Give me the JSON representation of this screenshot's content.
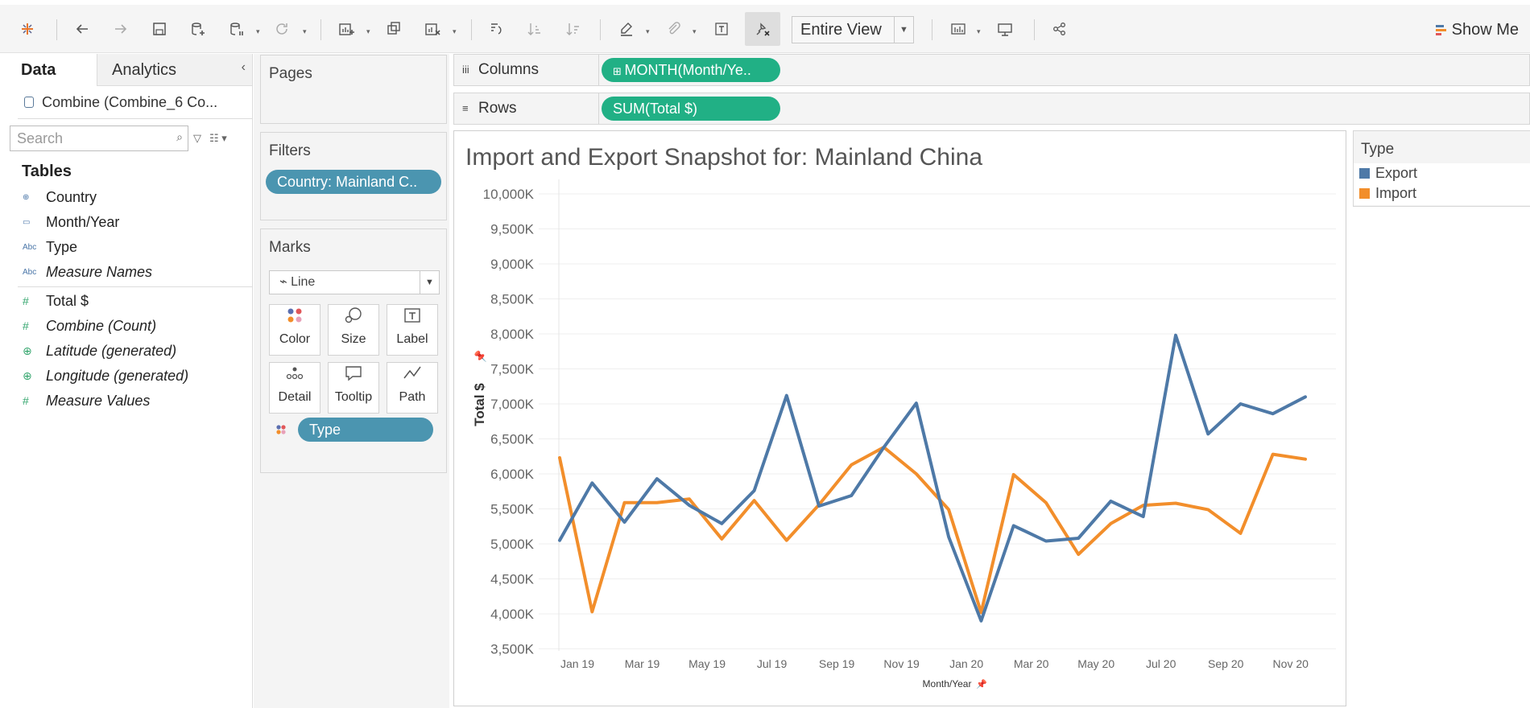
{
  "toolbar": {
    "fit_value": "Entire View",
    "show_me_label": "Show Me"
  },
  "left_pane": {
    "tabs": [
      {
        "label": "Data",
        "active": true
      },
      {
        "label": "Analytics",
        "active": false
      }
    ],
    "datasource": "Combine (Combine_6 Co...",
    "search_placeholder": "Search",
    "tables_heading": "Tables",
    "dimensions": [
      {
        "label": "Country",
        "icon": "globe-icon"
      },
      {
        "label": "Month/Year",
        "icon": "calendar-icon"
      },
      {
        "label": "Type",
        "icon": "abc-icon"
      },
      {
        "label": "Measure Names",
        "icon": "abc-icon"
      }
    ],
    "measures": [
      {
        "label": "Total $",
        "icon": "hash-icon"
      },
      {
        "label": "Combine (Count)",
        "icon": "hash-icon"
      },
      {
        "label": "Latitude (generated)",
        "icon": "globe-icon"
      },
      {
        "label": "Longitude (generated)",
        "icon": "globe-icon"
      },
      {
        "label": "Measure Values",
        "icon": "hash-icon"
      }
    ]
  },
  "pages_card": {
    "title": "Pages"
  },
  "filters_card": {
    "title": "Filters",
    "pill": "Country: Mainland C.."
  },
  "marks_card": {
    "title": "Marks",
    "mark_type": "Line",
    "buttons": [
      "Color",
      "Size",
      "Label",
      "Detail",
      "Tooltip",
      "Path"
    ],
    "pill": "Type"
  },
  "shelves": {
    "columns_label": "Columns",
    "columns_pill": "MONTH(Month/Ye..",
    "rows_label": "Rows",
    "rows_pill": "SUM(Total $)"
  },
  "legend": {
    "title": "Type",
    "items": [
      {
        "label": "Export",
        "color": "#4e79a7"
      },
      {
        "label": "Import",
        "color": "#f28e2b"
      }
    ]
  },
  "chart_data": {
    "type": "line",
    "title": "Import and Export Snapshot for: Mainland China",
    "xlabel": "Month/Year",
    "ylabel": "Total $",
    "x": [
      "Jan 19",
      "Feb 19",
      "Mar 19",
      "Apr 19",
      "May 19",
      "Jun 19",
      "Jul 19",
      "Aug 19",
      "Sep 19",
      "Oct 19",
      "Nov 19",
      "Dec 19",
      "Jan 20",
      "Feb 20",
      "Mar 20",
      "Apr 20",
      "May 20",
      "Jun 20",
      "Jul 20",
      "Aug 20",
      "Sep 20",
      "Oct 20",
      "Nov 20",
      "Dec 20"
    ],
    "x_tick_labels": [
      "Jan 19",
      "Mar 19",
      "May 19",
      "Jul 19",
      "Sep 19",
      "Nov 19",
      "Jan 20",
      "Mar 20",
      "May 20",
      "Jul 20",
      "Sep 20",
      "Nov 20"
    ],
    "y_tick_labels": [
      "10,000K",
      "9,500K",
      "9,000K",
      "8,500K",
      "8,000K",
      "7,500K",
      "7,000K",
      "6,500K",
      "6,000K",
      "5,500K",
      "5,000K",
      "4,500K",
      "4,000K",
      "3,500K"
    ],
    "ylim": [
      3500,
      10000
    ],
    "series": [
      {
        "name": "Export",
        "color": "#4e79a7",
        "values": [
          5050,
          5870,
          5310,
          5930,
          5550,
          5290,
          5760,
          7120,
          5540,
          5690,
          6380,
          7010,
          5100,
          3900,
          5260,
          5040,
          5080,
          5610,
          5390,
          7980,
          6570,
          7000,
          6860,
          7100
        ]
      },
      {
        "name": "Import",
        "color": "#f28e2b",
        "values": [
          6230,
          4030,
          5590,
          5590,
          5640,
          5070,
          5620,
          5050,
          5560,
          6130,
          6380,
          6000,
          5490,
          4020,
          5990,
          5590,
          4850,
          5290,
          5550,
          5580,
          5490,
          5150,
          6280,
          6210
        ]
      }
    ]
  }
}
